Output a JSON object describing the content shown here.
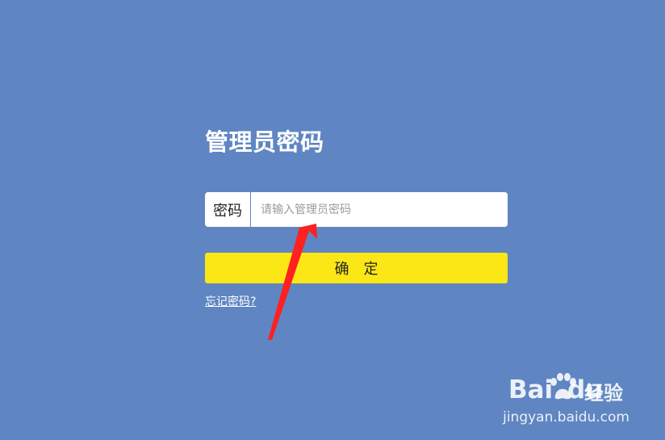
{
  "login": {
    "title": "管理员密码",
    "password_label": "密码",
    "password_value": "",
    "password_placeholder": "请输入管理员密码",
    "confirm_label": "确定",
    "forgot_password": "忘记密码?"
  },
  "watermark": {
    "brand_bai": "Bai",
    "brand_du": "du",
    "brand_experience": "经验",
    "url": "jingyan.baidu.com"
  },
  "colors": {
    "background": "#5f86c2",
    "button": "#fbe715",
    "annotation_arrow": "#ff2020"
  },
  "icons": {
    "annotation": "red-arrow-icon",
    "watermark": "baidu-paw-icon"
  }
}
